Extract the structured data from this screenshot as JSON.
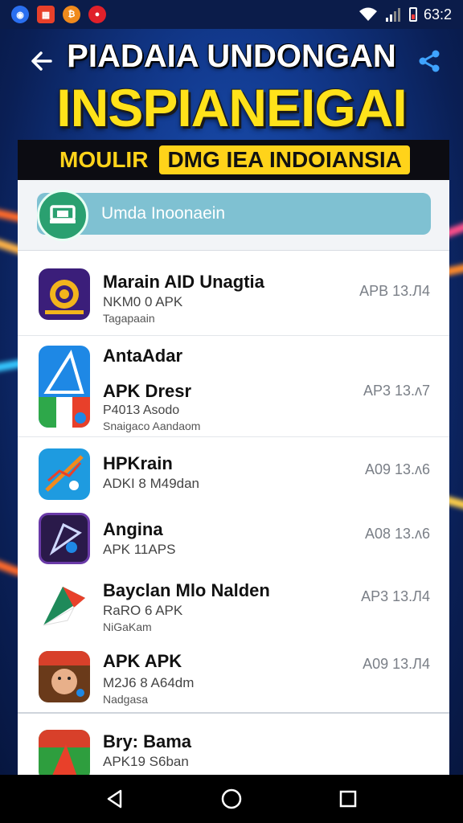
{
  "status_bar": {
    "icons": [
      {
        "name": "messenger-icon",
        "color": "#2a6ff0",
        "glyph": "◉"
      },
      {
        "name": "gallery-icon",
        "color": "#e8402a",
        "glyph": "▦"
      },
      {
        "name": "bitcoin-icon",
        "color": "#f08a1c",
        "glyph": "₿"
      },
      {
        "name": "record-icon",
        "color": "#e0202a",
        "glyph": "●"
      }
    ],
    "time": "63:2"
  },
  "header": {
    "title_line1": "PIADAIA UNDONGAN",
    "title_line2": "INSPIANEIGAI",
    "subtitle_a": "MOULIR",
    "subtitle_b": "DMG IEA INDOIANSIA"
  },
  "search": {
    "placeholder": "Umda Inoonaein"
  },
  "apps": [
    {
      "name": "Marain AID Unagtia",
      "line1": "NKM0 0 APK",
      "line2": "Tagapaain",
      "version": "APB 13.Л4",
      "icon": "gold-emblem-icon",
      "color": "#3b1e7a"
    },
    {
      "name": "AntaAdar",
      "line1": "APK Dresr",
      "line2": "P4013 Asodo",
      "line3": "Snaigaco Aandaom",
      "version": "AP3 13.ʌ7",
      "icon": "triangle-app-icon",
      "color": "#1e88e5"
    },
    {
      "name": "HPKrain",
      "line1": "ADKI 8 M49dan",
      "version": "A09 13.ʌ6",
      "icon": "chart-app-icon",
      "color": "#1e9be0"
    },
    {
      "name": "Angina",
      "line1": "APK 11APS",
      "version": "A08 13.ʌ6",
      "icon": "quill-app-icon",
      "color": "#2a1a4a"
    },
    {
      "name": "Bayclan Mlo Nalden",
      "line1": "RaRO 6 APK",
      "line2": "NiGaKam",
      "version": "AP3 13.Л4",
      "icon": "flag-app-icon",
      "color": "#ffffff"
    },
    {
      "name": "APK APK",
      "line1": "M2J6 8 A64dm",
      "line2": "Nadgasa",
      "version": "A09 13.Л4",
      "icon": "character-app-icon",
      "color": "#6a3a1a"
    },
    {
      "name": "Bry: Bama",
      "line1": "APK19 S6ban",
      "version": "",
      "icon": "game-app-icon",
      "color": "#2e9e3e"
    }
  ],
  "nav": {
    "back": "back-nav",
    "home": "home-nav",
    "recents": "recents-nav"
  }
}
